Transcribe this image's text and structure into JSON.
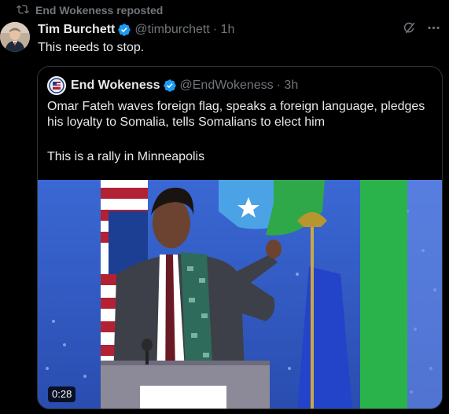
{
  "repost": {
    "label": "End Wokeness reposted",
    "icon": "retweet-icon"
  },
  "tweet": {
    "author_name": "Tim Burchett",
    "handle": "@timburchett",
    "time": "· 1h",
    "verified": true,
    "text": "This needs to stop.",
    "actions": {
      "grok_icon": "grok-icon",
      "more_icon": "more-icon"
    }
  },
  "quoted_tweet": {
    "author_name": "End Wokeness",
    "handle": "@EndWokeness",
    "time": "· 3h",
    "verified": true,
    "text_line1": "Omar Fateh waves foreign flag, speaks a foreign language, pledges his loyalty to Somalia, tells Somalians to elect him",
    "text_line2": "This is a rally in Minneapolis",
    "video": {
      "duration": "0:28"
    }
  },
  "colors": {
    "background": "#000000",
    "text": "#e7e9ea",
    "secondary": "#71767b",
    "verified": "#1d9bf0",
    "border": "#2f3336"
  }
}
